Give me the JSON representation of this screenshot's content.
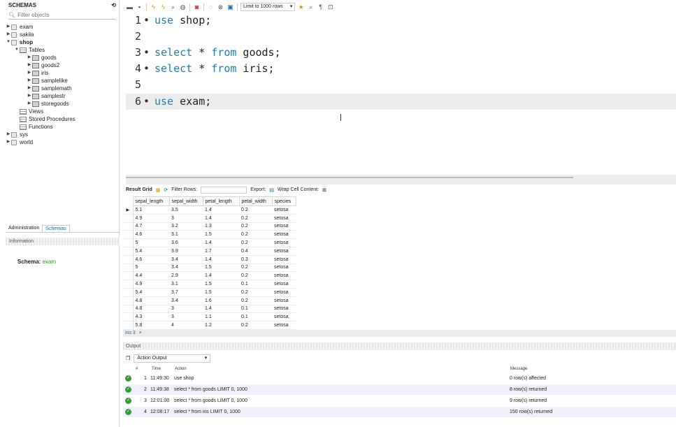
{
  "sidebar": {
    "title": "SCHEMAS",
    "filter_placeholder": "Filter objects",
    "tree": {
      "exam": "exam",
      "sakila": "sakila",
      "shop": "shop",
      "tables": "Tables",
      "table_items": [
        "goods",
        "goods2",
        "iris",
        "samplelike",
        "samplemath",
        "samplestr",
        "storegoods"
      ],
      "views": "Views",
      "stored_procedures": "Stored Procedures",
      "functions": "Functions",
      "sys": "sys",
      "world": "world"
    },
    "tabs": {
      "administration": "Administration",
      "schemas": "Schemas"
    },
    "information_label": "Information",
    "schema_label": "Schema:",
    "schema_value": "exam"
  },
  "toolbar": {
    "limit_label": "Limit to 1000 rows",
    "limit_arrow": "▾"
  },
  "editor": {
    "lines": [
      {
        "num": "1",
        "dot": "•",
        "kw": "use",
        "rest": " shop;"
      },
      {
        "num": "2",
        "dot": "",
        "kw": "",
        "rest": ""
      },
      {
        "num": "3",
        "dot": "•",
        "kw": "select",
        "mid": " * ",
        "kw2": "from",
        "rest": " goods;"
      },
      {
        "num": "4",
        "dot": "•",
        "kw": "select",
        "mid": " * ",
        "kw2": "from",
        "rest": " iris;"
      },
      {
        "num": "5",
        "dot": "",
        "kw": "",
        "rest": ""
      },
      {
        "num": "6",
        "dot": "•",
        "kw": "use",
        "rest": " exam;"
      }
    ]
  },
  "result": {
    "label": "Result Grid",
    "filter_rows": "Filter Rows:",
    "export": "Export:",
    "wrap": "Wrap Cell Content:",
    "columns": [
      "sepal_length",
      "sepal_width",
      "petal_length",
      "petal_width",
      "species"
    ],
    "rows": [
      [
        "5.1",
        "3.5",
        "1.4",
        "0.2",
        "setosa"
      ],
      [
        "4.9",
        "3",
        "1.4",
        "0.2",
        "setosa"
      ],
      [
        "4.7",
        "3.2",
        "1.3",
        "0.2",
        "setosa"
      ],
      [
        "4.6",
        "3.1",
        "1.5",
        "0.2",
        "setosa"
      ],
      [
        "5",
        "3.6",
        "1.4",
        "0.2",
        "setosa"
      ],
      [
        "5.4",
        "3.9",
        "1.7",
        "0.4",
        "setosa"
      ],
      [
        "4.6",
        "3.4",
        "1.4",
        "0.3",
        "setosa"
      ],
      [
        "5",
        "3.4",
        "1.5",
        "0.2",
        "setosa"
      ],
      [
        "4.4",
        "2.9",
        "1.4",
        "0.2",
        "setosa"
      ],
      [
        "4.9",
        "3.1",
        "1.5",
        "0.1",
        "setosa"
      ],
      [
        "5.4",
        "3.7",
        "1.5",
        "0.2",
        "setosa"
      ],
      [
        "4.8",
        "3.4",
        "1.6",
        "0.2",
        "setosa"
      ],
      [
        "4.8",
        "3",
        "1.4",
        "0.1",
        "setosa"
      ],
      [
        "4.3",
        "3",
        "1.1",
        "0.1",
        "setosa"
      ],
      [
        "5.8",
        "4",
        "1.2",
        "0.2",
        "setosa"
      ]
    ],
    "tab_label": "iris 3",
    "tab_close": "×"
  },
  "output": {
    "title": "Output",
    "selector": "Action Output",
    "headers": {
      "num": "#",
      "time": "Time",
      "action": "Action",
      "message": "Message"
    },
    "rows": [
      {
        "num": "1",
        "time": "11:49:30",
        "action": "use shop",
        "message": "0 row(s) affected"
      },
      {
        "num": "2",
        "time": "11:49:38",
        "action": "select * from goods LIMIT 0, 1000",
        "message": "8 row(s) returned"
      },
      {
        "num": "3",
        "time": "12:01:00",
        "action": "select * from goods LIMIT 0, 1000",
        "message": "9 row(s) returned"
      },
      {
        "num": "4",
        "time": "12:08:17",
        "action": "select * from iris LIMIT 0, 1000",
        "message": "150 row(s) returned"
      }
    ]
  }
}
